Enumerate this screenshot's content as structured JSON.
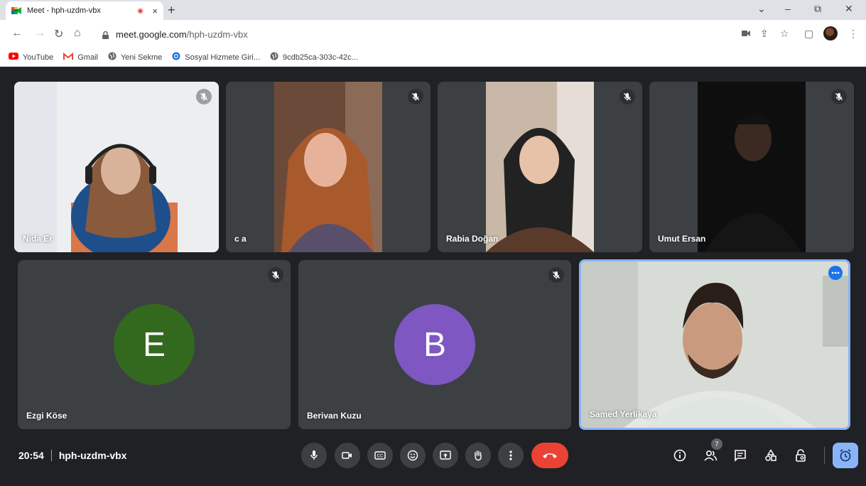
{
  "browser": {
    "tab_title": "Meet - hph-uzdm-vbx",
    "tab_close": "×",
    "new_tab": "+",
    "url_host": "meet.google.com",
    "url_path": "/hph-uzdm-vbx",
    "controls": {
      "minimize": "–",
      "restore": "⧉",
      "close": "✕",
      "tab_list": "⌄"
    }
  },
  "bookmarks": [
    {
      "label": "YouTube",
      "icon": "youtube-icon"
    },
    {
      "label": "Gmail",
      "icon": "gmail-icon"
    },
    {
      "label": "Yeni Sekme",
      "icon": "globe-icon"
    },
    {
      "label": "Sosyal Hizmete Giri...",
      "icon": "site-icon"
    },
    {
      "label": "9cdb25ca-303c-42c...",
      "icon": "globe-icon"
    }
  ],
  "participants": [
    {
      "name": "Nida Er",
      "muted": true
    },
    {
      "name": "c a",
      "muted": true
    },
    {
      "name": "Rabia Doğan",
      "muted": true
    },
    {
      "name": "Umut Ersan",
      "muted": true
    },
    {
      "name": "Ezgi Köse",
      "muted": true,
      "initial": "E",
      "avatar_color": "#33691e"
    },
    {
      "name": "Berivan Kuzu",
      "muted": true,
      "initial": "B",
      "avatar_color": "#7e57c2"
    },
    {
      "name": "Samed Yerlikaya",
      "muted": false,
      "self": true
    }
  ],
  "meeting": {
    "time": "20:54",
    "code": "hph-uzdm-vbx",
    "participant_count": "7"
  },
  "colors": {
    "accent": "#8ab4f8",
    "end_call": "#ea4335",
    "active_border": "#8ab4f8"
  }
}
